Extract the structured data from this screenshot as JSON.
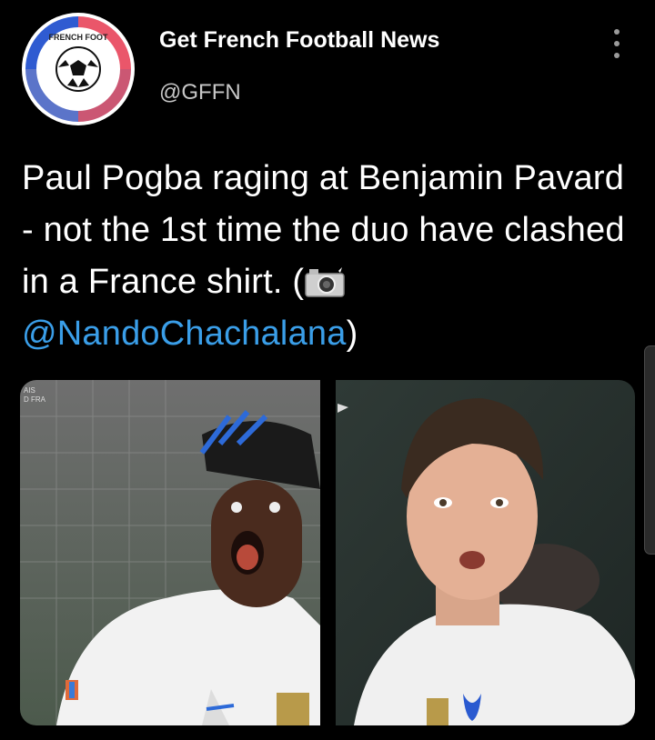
{
  "account": {
    "display_name": "Get French Football News",
    "handle": "@GFFN",
    "logo_text": "GET FRENCH FOOTBALL NEWS"
  },
  "tweet": {
    "text_before": "Paul Pogba raging at Benjamin Pavard - not the 1st time the duo have clashed in a France shirt. (",
    "mention": "@NandoChachalana",
    "text_after": ")"
  },
  "media": {
    "left_overlay": "AIS\nD FRA",
    "left_alt": "Paul Pogba shouting",
    "right_alt": "Benjamin Pavard"
  },
  "icons": {
    "more": "more-vertical-icon",
    "camera": "camera-with-flash-emoji"
  },
  "colors": {
    "background": "#000000",
    "mention": "#3a9ee8",
    "handle": "#c7c7c7"
  }
}
